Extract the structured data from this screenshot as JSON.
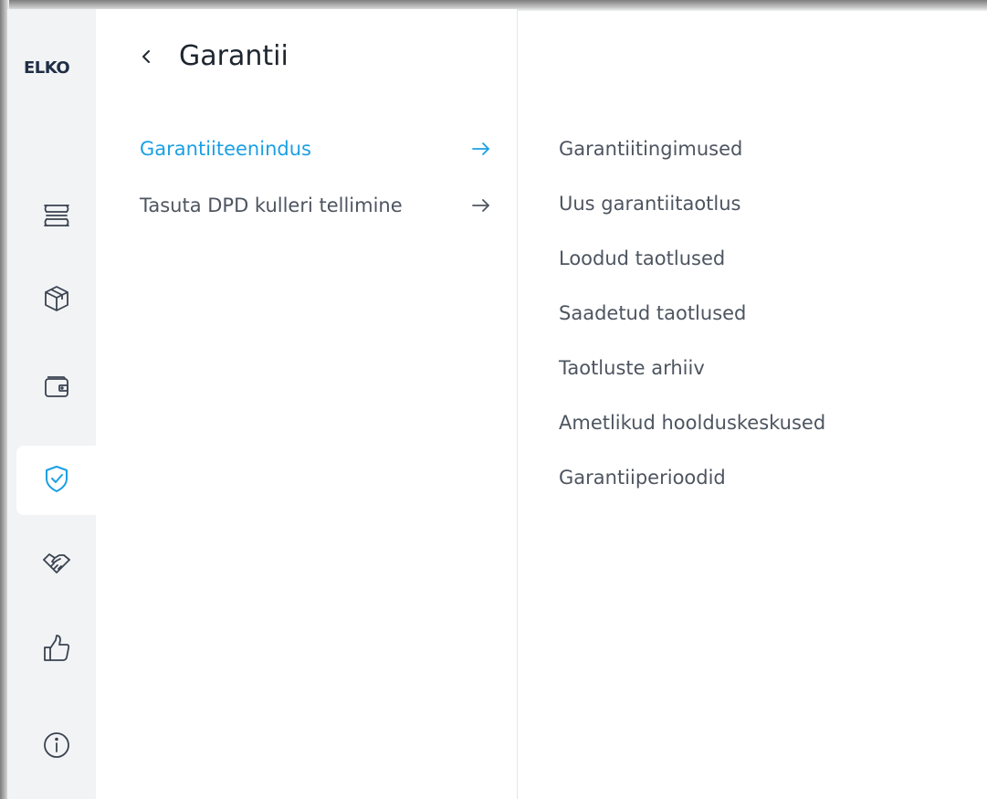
{
  "rail": {
    "logo": "ELKO",
    "icons": [
      {
        "name": "stack-icon",
        "active": false
      },
      {
        "name": "package-icon",
        "active": false
      },
      {
        "name": "wallet-icon",
        "active": false
      },
      {
        "name": "shield-check-icon",
        "active": true
      },
      {
        "name": "handshake-icon",
        "active": false
      },
      {
        "name": "thumbs-up-icon",
        "active": false
      },
      {
        "name": "info-icon",
        "active": false
      }
    ],
    "icon_color": "#3a4350",
    "active_icon_color": "#1aa0e3"
  },
  "header": {
    "title": "Garantii"
  },
  "menu": [
    {
      "label": "Garantiiteenindus",
      "active": true
    },
    {
      "label": "Tasuta DPD kulleri tellimine",
      "active": false
    }
  ],
  "submenu": [
    {
      "label": "Garantiitingimused"
    },
    {
      "label": "Uus garantiitaotlus"
    },
    {
      "label": "Loodud taotlused"
    },
    {
      "label": "Saadetud taotlused"
    },
    {
      "label": "Taotluste arhiiv"
    },
    {
      "label": "Ametlikud hoolduskeskused"
    },
    {
      "label": "Garantiiperioodid"
    }
  ],
  "colors": {
    "accent": "#1aa0e3",
    "text": "#4d5560",
    "title": "#1e2630",
    "rail_bg": "#f1f3f5"
  }
}
